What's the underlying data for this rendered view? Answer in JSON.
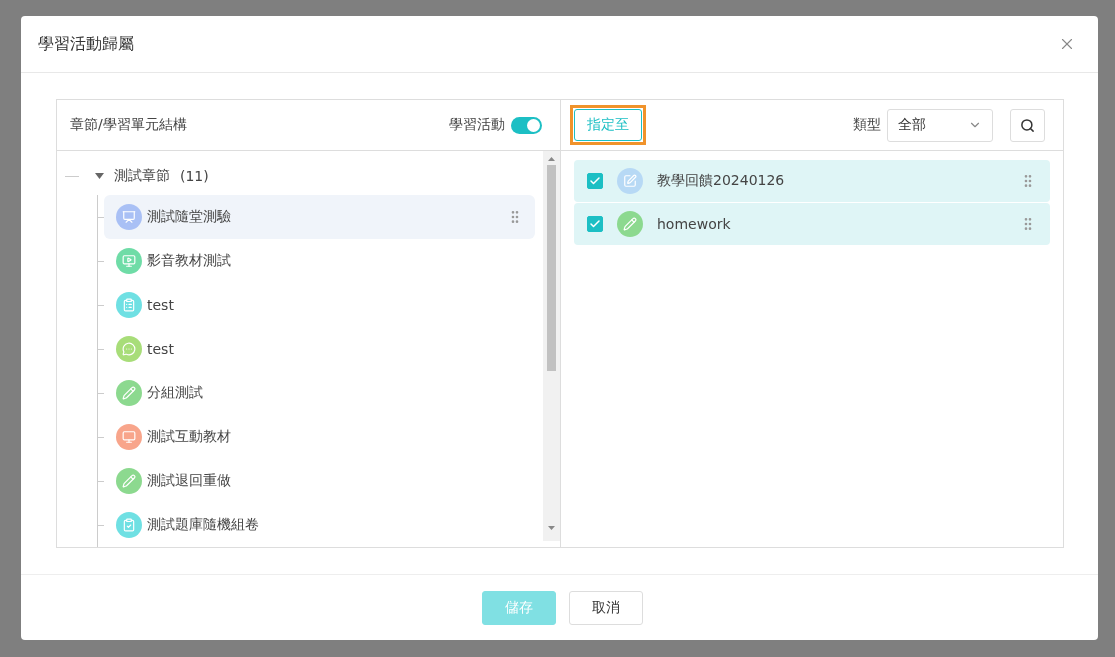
{
  "dialog": {
    "title": "學習活動歸屬"
  },
  "left_pane": {
    "title": "章節/學習單元結構",
    "toggle": {
      "label": "學習活動",
      "on": true
    },
    "tree": [
      {
        "label": "測試章節",
        "count": "(11)",
        "expanded": true,
        "children": [
          {
            "label": "測試隨堂測驗",
            "kind": "quiz",
            "selected": true
          },
          {
            "label": "影音教材測試",
            "kind": "video",
            "selected": false
          },
          {
            "label": "test",
            "kind": "form",
            "selected": false
          },
          {
            "label": "test",
            "kind": "discussion",
            "selected": false
          },
          {
            "label": "分組測試",
            "kind": "assignment",
            "selected": false
          },
          {
            "label": "測試互動教材",
            "kind": "interactive",
            "selected": false
          },
          {
            "label": "測試退回重做",
            "kind": "assignment",
            "selected": false
          },
          {
            "label": "測試題庫隨機組卷",
            "kind": "exam",
            "selected": false
          }
        ]
      }
    ]
  },
  "right_pane": {
    "assign_button": "指定至",
    "type_label": "類型",
    "type_select": "全部",
    "items": [
      {
        "label": "教學回饋20240126",
        "kind": "feedback",
        "checked": true
      },
      {
        "label": "homework",
        "kind": "assignment",
        "checked": true
      }
    ]
  },
  "buttons": [
    {
      "label": "儲存",
      "kind": "primary",
      "disabled": true
    },
    {
      "label": "取消",
      "kind": "default",
      "disabled": false
    }
  ]
}
